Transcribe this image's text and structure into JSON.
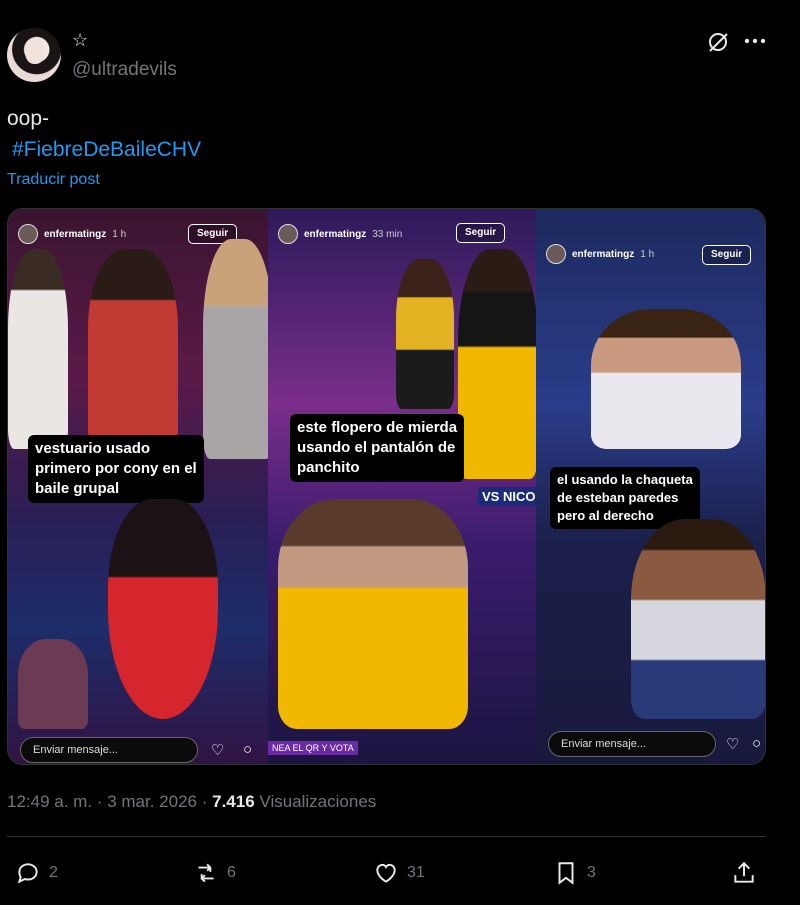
{
  "author": {
    "badge_glyph": "☆",
    "handle": "@ultradevils"
  },
  "post": {
    "text": "oop-",
    "hashtag": "#FiebreDeBaileCHV",
    "translate_label": "Traducir post"
  },
  "media": {
    "stories": [
      {
        "user": "enfermatingz",
        "time": "1 h",
        "follow_label": "Seguir",
        "caption": [
          "vestuario usado",
          "primero por cony en el",
          "baile grupal"
        ],
        "reply_placeholder": "Enviar mensaje..."
      },
      {
        "user": "enfermatingz",
        "time": "33 min",
        "follow_label": "Seguir",
        "caption": [
          "este flopero de mierda",
          "usando el pantalón de",
          "panchito"
        ],
        "overlay_text": "VS NICO",
        "bottom_text": "NEA EL QR Y VOTA"
      },
      {
        "user": "enfermatingz",
        "time": "1 h",
        "follow_label": "Seguir",
        "caption": [
          "el usando la chaqueta",
          "de esteban paredes",
          "pero al derecho"
        ],
        "reply_placeholder": "Enviar mensaje..."
      }
    ]
  },
  "meta": {
    "time": "12:49 a. m.",
    "separator": "·",
    "date": "3 mar. 2026",
    "views_count": "7.416",
    "views_label": "Visualizaciones"
  },
  "actions": {
    "replies": "2",
    "reposts": "6",
    "likes": "31",
    "bookmarks": "3"
  },
  "colors": {
    "accent": "#1d9bf0",
    "secondary_text": "#71767b",
    "background": "#000000"
  }
}
